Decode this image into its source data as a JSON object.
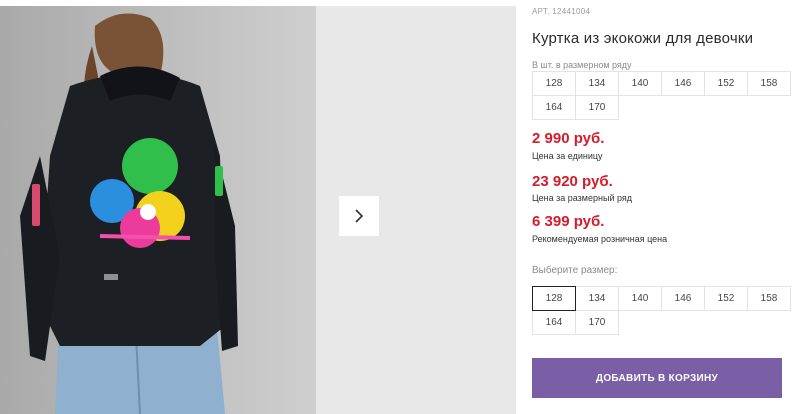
{
  "product": {
    "article": "АРТ. 12441004",
    "title": "Куртка из экокожи для девочки"
  },
  "sizes_in_row": {
    "label": "В шт. в размерном ряду",
    "sizes": [
      "128",
      "134",
      "140",
      "146",
      "152",
      "158",
      "164",
      "170"
    ]
  },
  "prices": {
    "unit": {
      "value": "2 990 руб.",
      "label": "Цена за единицу"
    },
    "row": {
      "value": "23 920 руб.",
      "label": "Цена за размерный ряд"
    },
    "retail": {
      "value": "6 399 руб.",
      "label": "Рекомендуемая розничная цена"
    }
  },
  "size_select": {
    "label": "Выберите размер:",
    "sizes": [
      "128",
      "134",
      "140",
      "146",
      "152",
      "158",
      "164",
      "170"
    ],
    "selected": "128"
  },
  "cart": {
    "button_label": "ДОБАВИТЬ В КОРЗИНУ"
  },
  "gallery": {
    "next_icon": "chevron-right-icon"
  },
  "colors": {
    "price": "#d41c2c",
    "accent": "#7b5fa6"
  }
}
